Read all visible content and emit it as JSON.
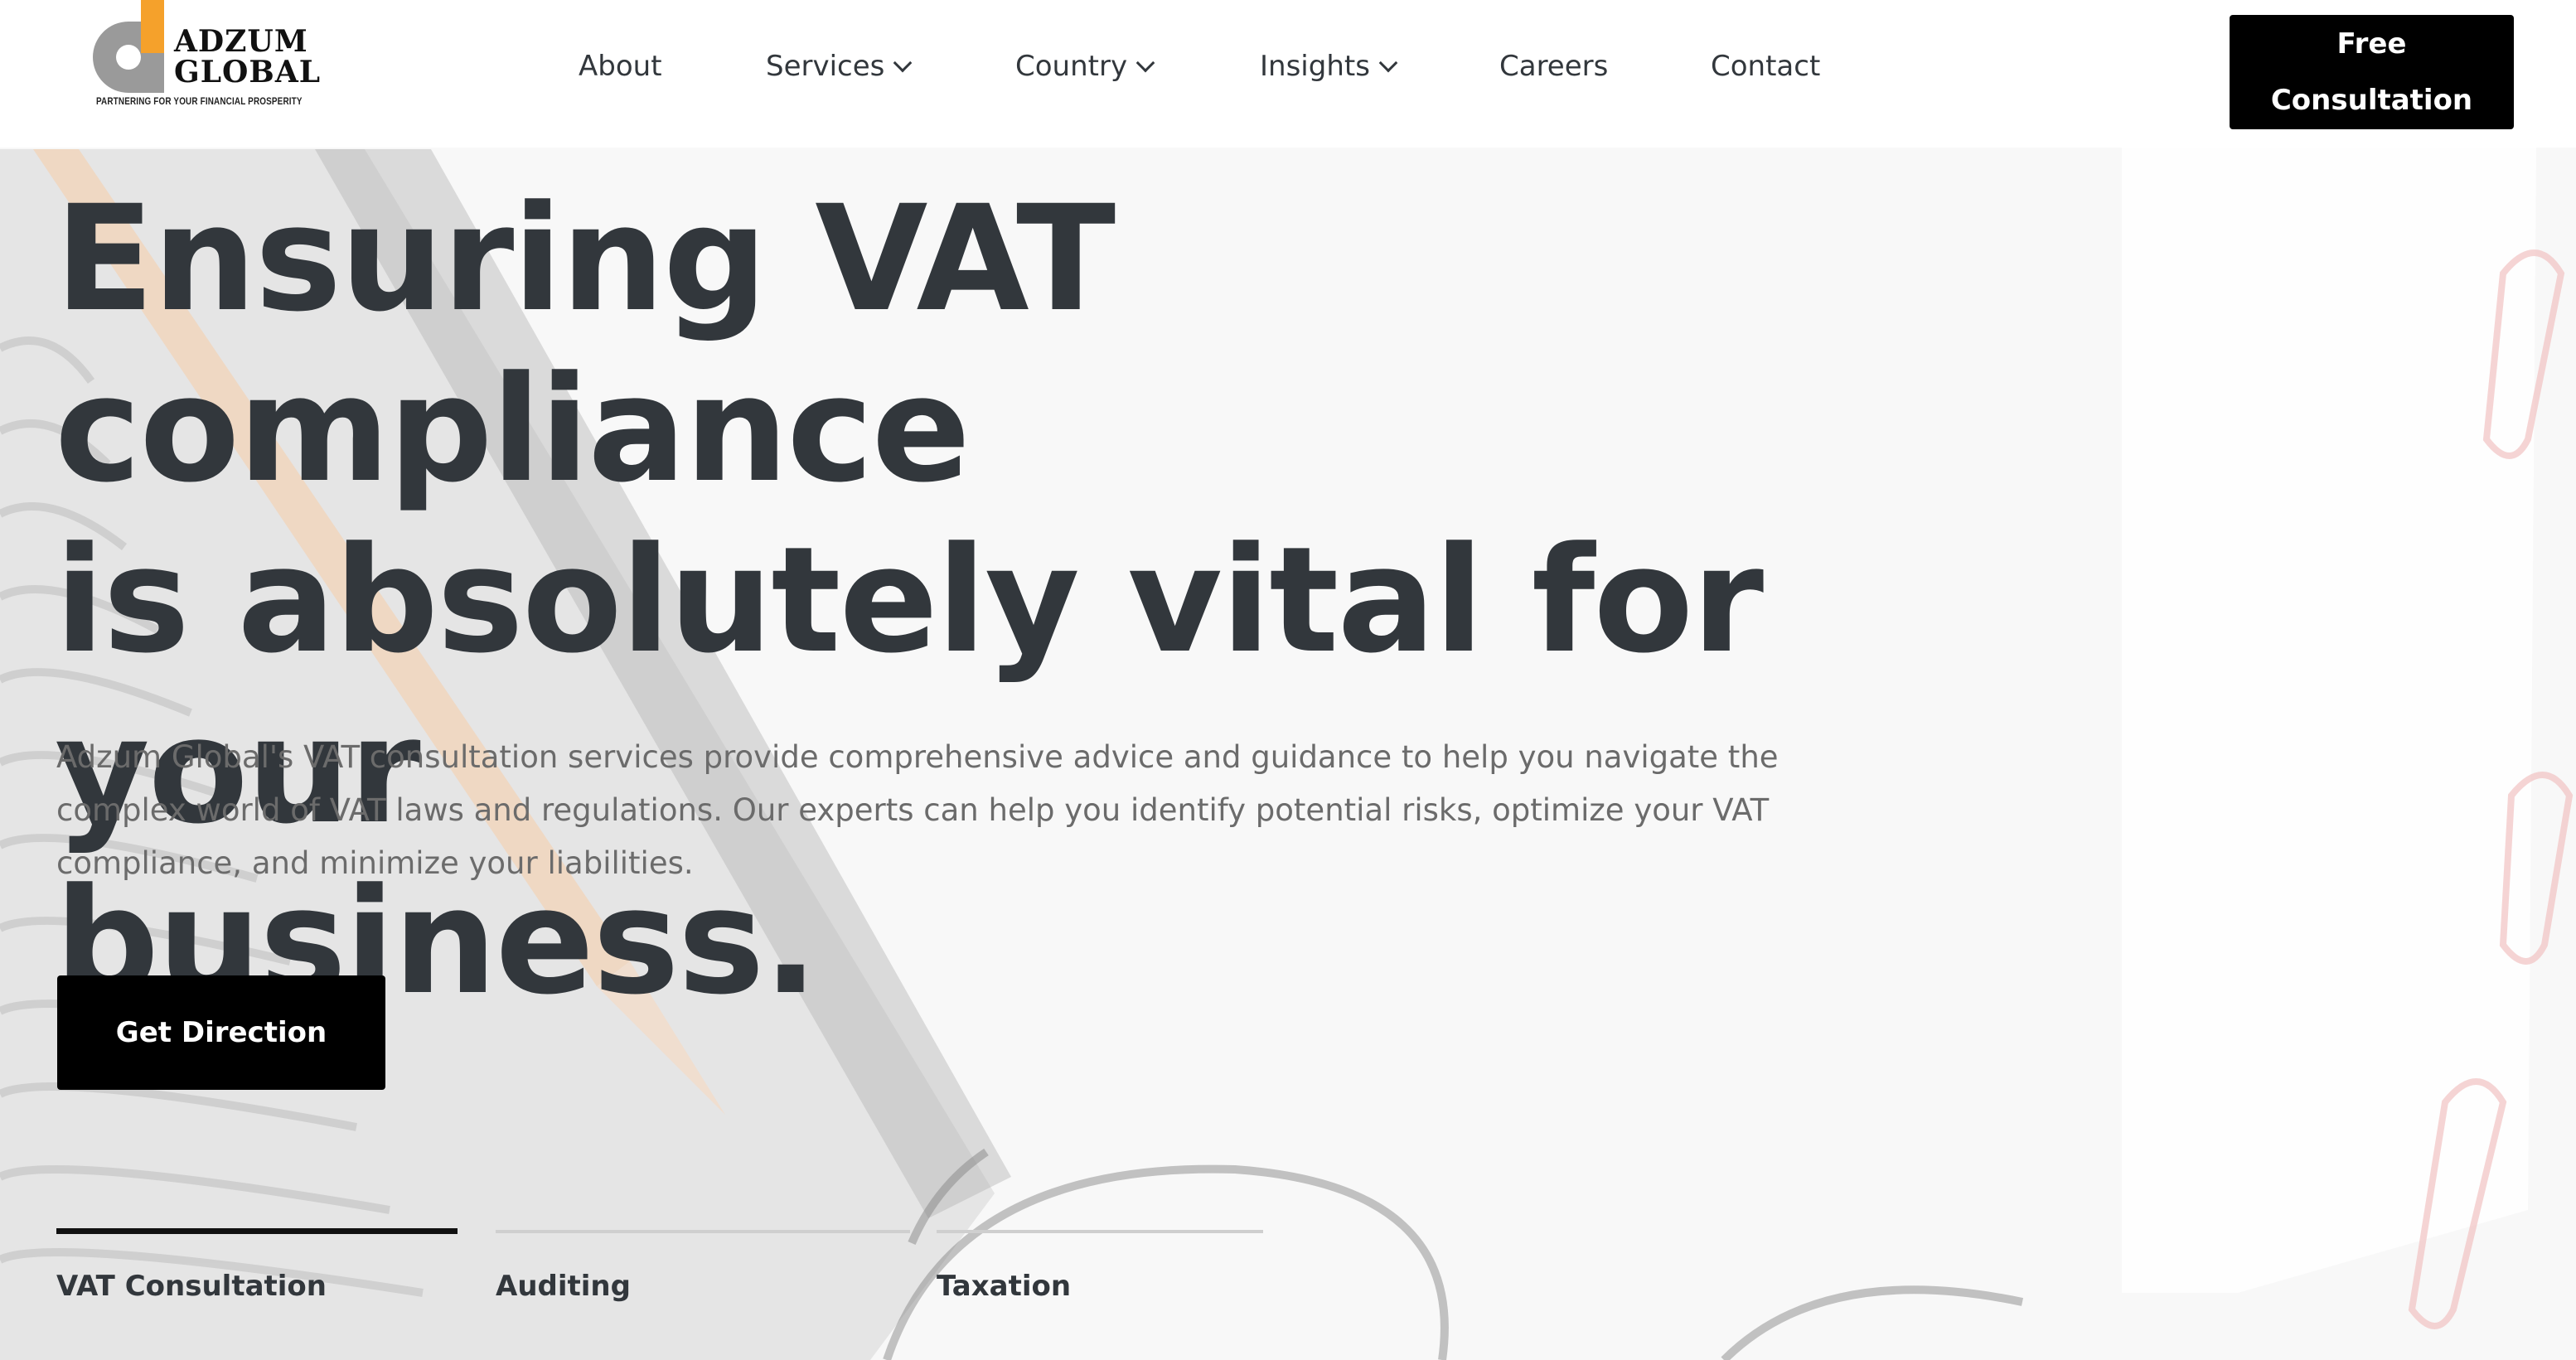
{
  "brand": {
    "name_line1": "ADZUM",
    "name_line2": "GLOBAL",
    "tagline": "PARTNERING FOR YOUR FINANCIAL PROSPERITY",
    "accent_color": "#f5a12b"
  },
  "nav": {
    "items": [
      {
        "label": "About",
        "has_dropdown": false
      },
      {
        "label": "Services",
        "has_dropdown": true
      },
      {
        "label": "Country",
        "has_dropdown": true
      },
      {
        "label": "Insights",
        "has_dropdown": true
      },
      {
        "label": "Careers",
        "has_dropdown": false
      },
      {
        "label": "Contact",
        "has_dropdown": false
      }
    ],
    "cta_line1": "Free",
    "cta_line2": "Consultation"
  },
  "hero": {
    "title_line1": "Ensuring VAT compliance",
    "title_line2": "is absolutely vital for your",
    "title_line3": "business.",
    "description": "Adzum Global's VAT consultation services provide comprehensive advice and guidance to help you navigate the complex world of VAT laws and regulations. Our experts can help you identify potential risks, optimize your VAT compliance, and minimize your liabilities.",
    "button_label": "Get Direction"
  },
  "tabs": [
    {
      "label": "VAT Consultation",
      "active": true
    },
    {
      "label": "Auditing",
      "active": false
    },
    {
      "label": "Taxation",
      "active": false
    }
  ],
  "colors": {
    "text_dark": "#32373c",
    "button_bg": "#000000",
    "button_text": "#ffffff"
  }
}
